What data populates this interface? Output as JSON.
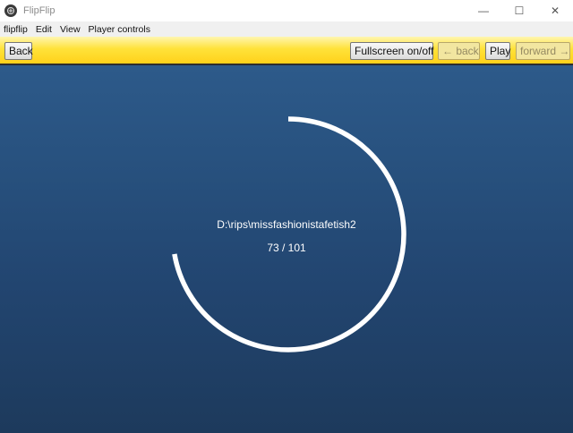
{
  "window": {
    "title": "FlipFlip",
    "icon": "flipflip-app-icon",
    "controls": {
      "minimize": "—",
      "maximize": "☐",
      "close": "✕"
    }
  },
  "menu": {
    "items": [
      {
        "label": "flipflip"
      },
      {
        "label": "Edit"
      },
      {
        "label": "View"
      },
      {
        "label": "Player controls"
      }
    ]
  },
  "toolbar": {
    "back_label": "Back",
    "fullscreen_label": "Fullscreen on/off",
    "prev_label": "← back",
    "play_label": "Play",
    "forward_label": "forward →",
    "colors": {
      "bar": "#ffd11a",
      "disabled_text": "#958a62"
    }
  },
  "player": {
    "path": "D:\\rips\\missfashionistafetish2",
    "progress_text": "73 / 101",
    "progress": {
      "current": 73,
      "total": 101
    },
    "colors": {
      "background": "#2d5a8a",
      "ring": "#ffffff"
    }
  }
}
